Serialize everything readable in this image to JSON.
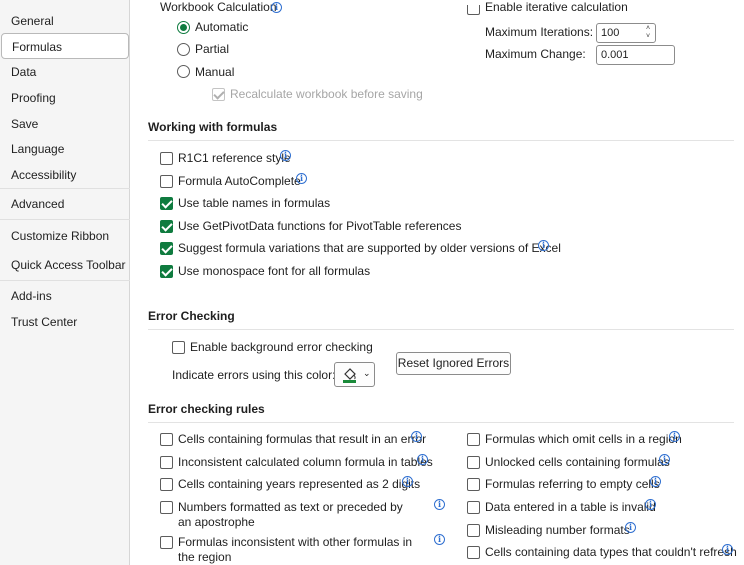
{
  "sidebar": {
    "items": [
      {
        "label": "General",
        "selected": false
      },
      {
        "label": "Formulas",
        "selected": true
      },
      {
        "label": "Data",
        "selected": false
      },
      {
        "label": "Proofing",
        "selected": false
      },
      {
        "label": "Save",
        "selected": false
      },
      {
        "label": "Language",
        "selected": false
      },
      {
        "label": "Accessibility",
        "selected": false
      },
      {
        "label": "Advanced",
        "selected": false
      },
      {
        "label": "Customize Ribbon",
        "selected": false
      },
      {
        "label": "Quick Access Toolbar",
        "selected": false
      },
      {
        "label": "Add-ins",
        "selected": false
      },
      {
        "label": "Trust Center",
        "selected": false
      }
    ]
  },
  "calc": {
    "title": "Workbook Calculation",
    "options": [
      {
        "label": "Automatic",
        "checked": true
      },
      {
        "label": "Partial",
        "checked": false
      },
      {
        "label": "Manual",
        "checked": false
      }
    ],
    "recalc_label": "Recalculate workbook before saving",
    "recalc_checked": true,
    "iterative_label": "Enable iterative calculation",
    "iterative_checked": false,
    "max_iter_label": "Maximum Iterations:",
    "max_iter_value": "100",
    "max_change_label": "Maximum Change:",
    "max_change_value": "0.001"
  },
  "working": {
    "title": "Working with formulas",
    "items": [
      {
        "label": "R1C1 reference style",
        "checked": false,
        "info": true
      },
      {
        "label": "Formula AutoComplete",
        "checked": false,
        "info": true
      },
      {
        "label": "Use table names in formulas",
        "checked": true,
        "info": false
      },
      {
        "label": "Use GetPivotData functions for PivotTable references",
        "checked": true,
        "info": false
      },
      {
        "label": "Suggest formula variations that are supported by older versions of Excel",
        "checked": true,
        "info": true
      },
      {
        "label": "Use monospace font for all formulas",
        "checked": true,
        "info": false
      }
    ]
  },
  "errorChecking": {
    "title": "Error Checking",
    "enable_label": "Enable background error checking",
    "enable_checked": false,
    "indicate_label": "Indicate errors using this color:",
    "color_accent": "#1a8a3a",
    "reset_label": "Reset Ignored Errors"
  },
  "rules": {
    "title": "Error checking rules",
    "left": [
      {
        "label": "Cells containing formulas that result in an error",
        "checked": false
      },
      {
        "label": "Inconsistent calculated column formula in tables",
        "checked": false
      },
      {
        "label": "Cells containing years represented as 2 digits",
        "checked": false
      },
      {
        "label": "Numbers formatted as text or preceded by an apostrophe",
        "checked": false
      },
      {
        "label": "Formulas inconsistent with other formulas in the region",
        "checked": false
      }
    ],
    "right": [
      {
        "label": "Formulas which omit cells in a region",
        "checked": false
      },
      {
        "label": "Unlocked cells containing formulas",
        "checked": false
      },
      {
        "label": "Formulas referring to empty cells",
        "checked": false
      },
      {
        "label": "Data entered in a table is invalid",
        "checked": false
      },
      {
        "label": "Misleading number formats",
        "checked": false
      },
      {
        "label": "Cells containing data types that couldn't refresh",
        "checked": false
      }
    ]
  },
  "icons": {
    "info": "info-icon",
    "paint": "paint-bucket-icon",
    "chevron": "chevron-down-icon"
  }
}
